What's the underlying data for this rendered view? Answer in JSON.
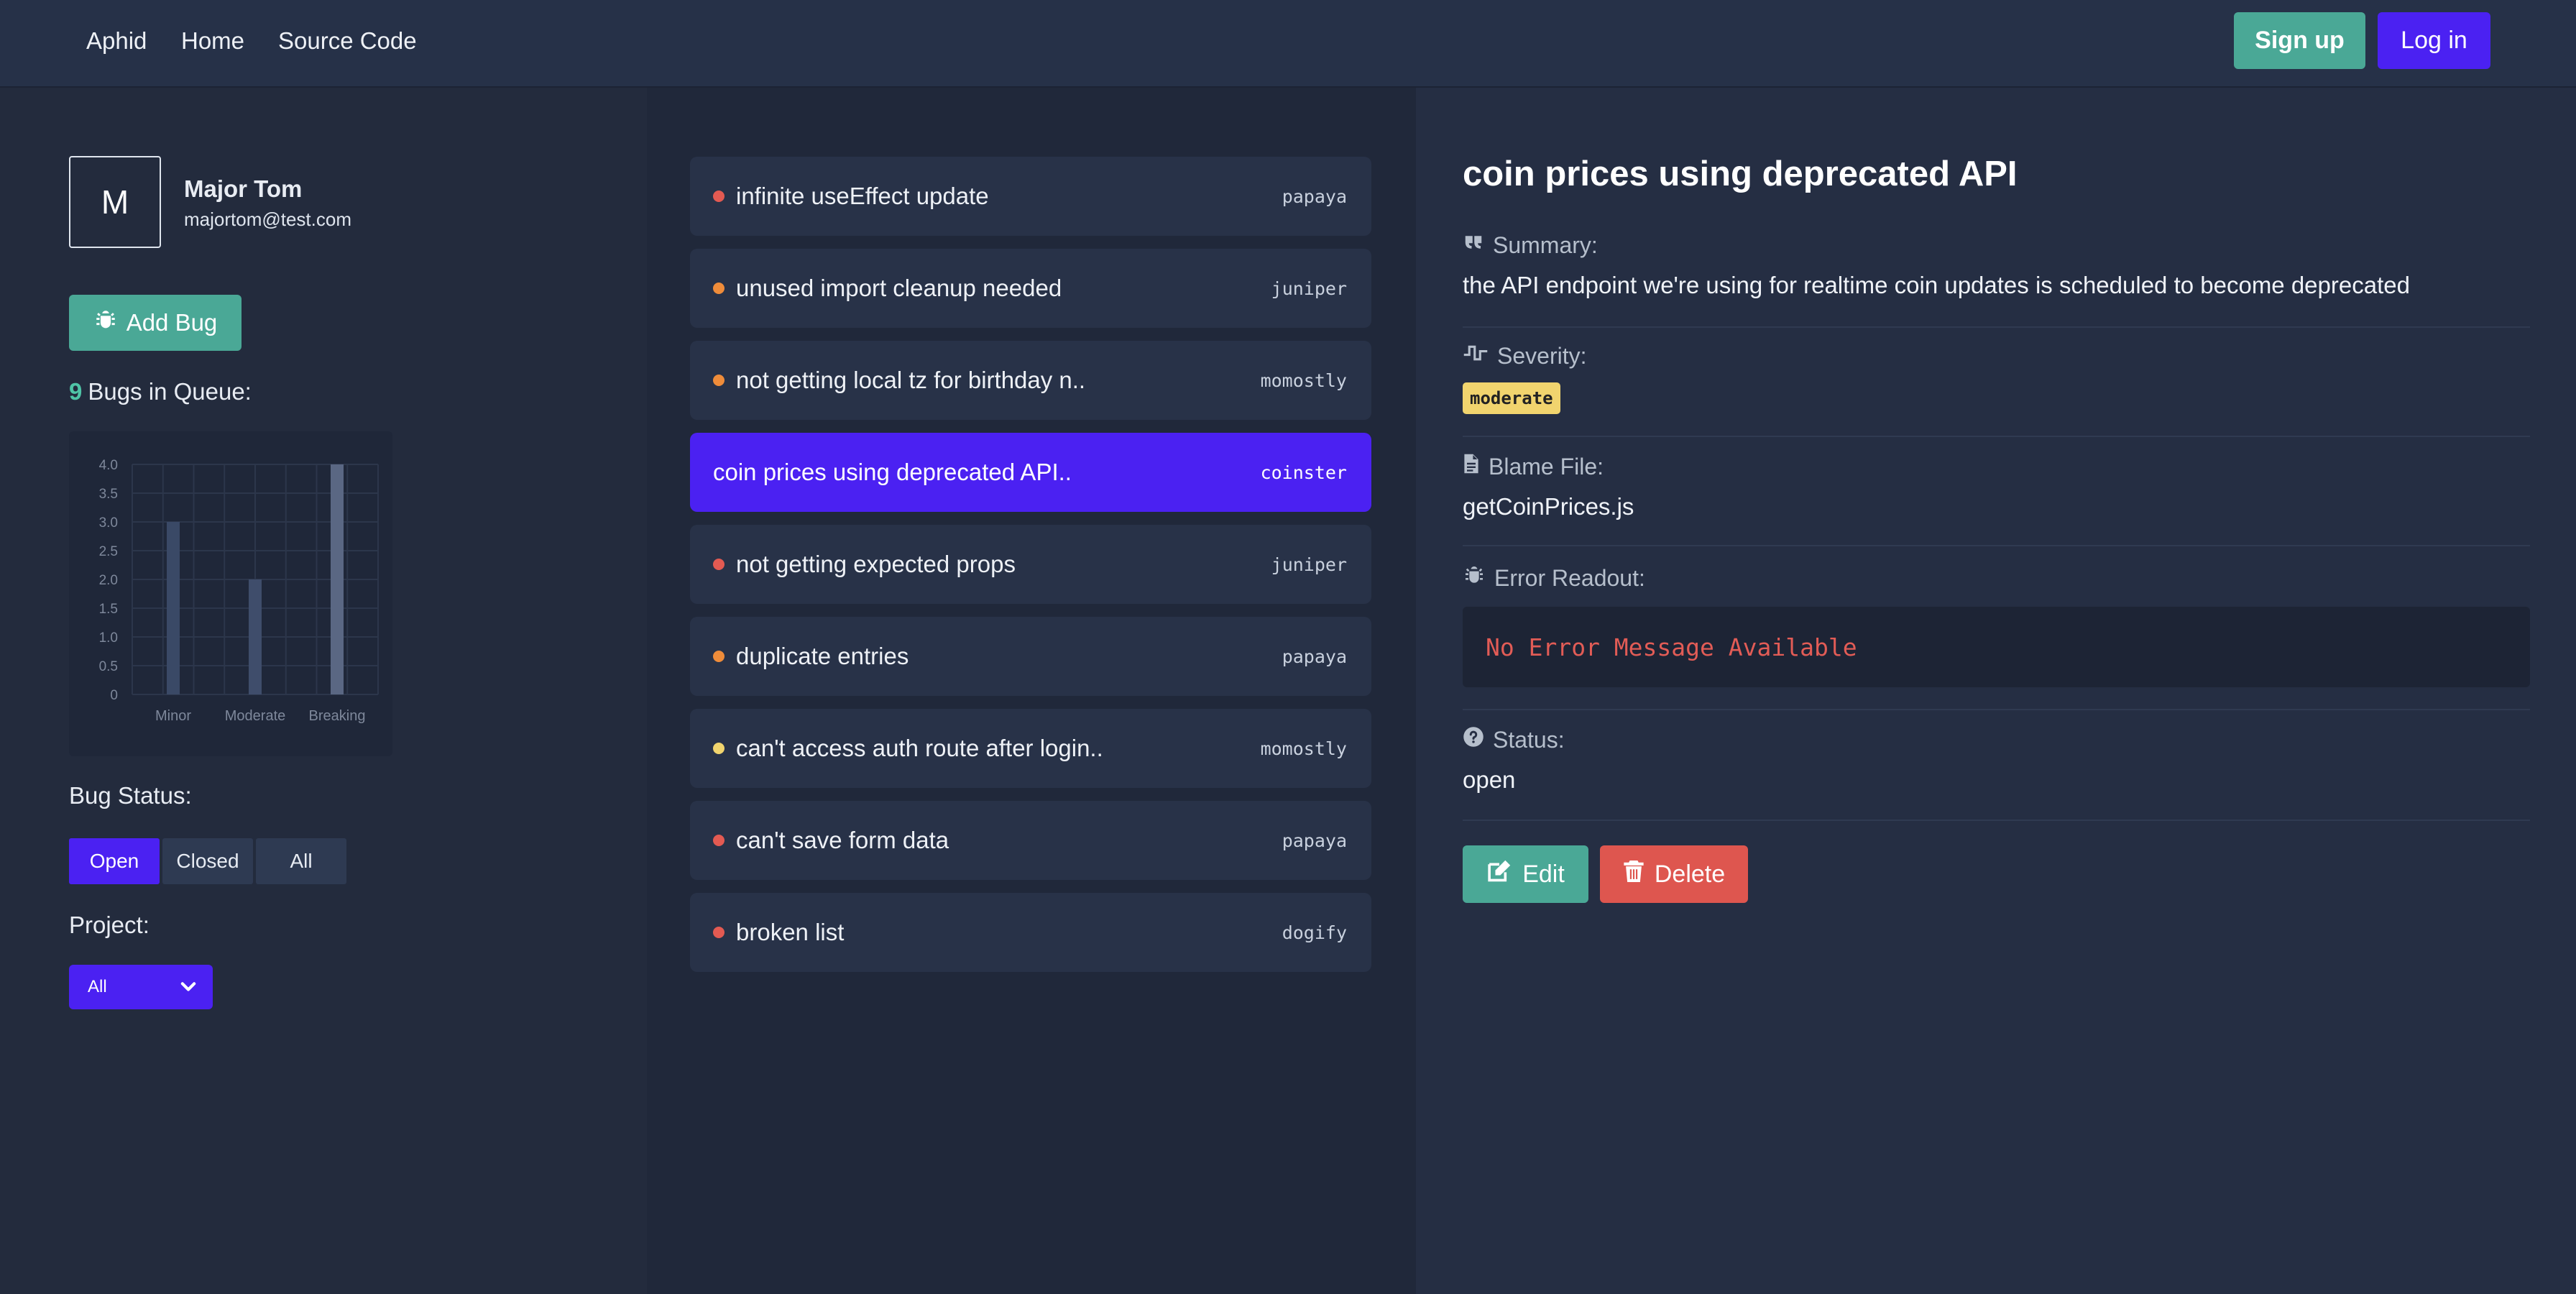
{
  "nav": {
    "brand": "Aphid",
    "links": [
      "Home",
      "Source Code"
    ],
    "signup_label": "Sign up",
    "login_label": "Log in"
  },
  "user": {
    "initial": "M",
    "name": "Major Tom",
    "email": "majortom@test.com"
  },
  "sidebar": {
    "add_bug_label": "Add Bug",
    "queue_count": "9",
    "queue_label": "Bugs in Queue:",
    "bug_status_label": "Bug Status:",
    "status_filters": [
      "Open",
      "Closed",
      "All"
    ],
    "active_filter": "Open",
    "project_label": "Project:",
    "project_selected": "All"
  },
  "chart_data": {
    "type": "bar",
    "categories": [
      "Minor",
      "Moderate",
      "Breaking"
    ],
    "values": [
      3,
      2,
      4
    ],
    "ylim": [
      0,
      4
    ],
    "yticks": [
      "0",
      "0.5",
      "1.0",
      "1.5",
      "2.0",
      "2.5",
      "3.0",
      "3.5",
      "4.0"
    ],
    "grid": true,
    "colors": [
      "#3a4966",
      "#3f4d6b",
      "#5a6783"
    ]
  },
  "bugs": [
    {
      "title": "infinite useEffect update",
      "project": "papaya",
      "color": "#e35a52"
    },
    {
      "title": "unused import cleanup needed",
      "project": "juniper",
      "color": "#ef8c3a"
    },
    {
      "title": "not getting local tz for birthday n..",
      "project": "momostly",
      "color": "#ef8c3a"
    },
    {
      "title": "coin prices using deprecated API..",
      "project": "coinster",
      "color": "",
      "selected": true
    },
    {
      "title": "not getting expected props",
      "project": "juniper",
      "color": "#e35a52"
    },
    {
      "title": "duplicate entries",
      "project": "papaya",
      "color": "#ef8c3a"
    },
    {
      "title": "can't access auth route after login..",
      "project": "momostly",
      "color": "#f1d46e"
    },
    {
      "title": "can't save form data",
      "project": "papaya",
      "color": "#e35a52"
    },
    {
      "title": "broken list",
      "project": "dogify",
      "color": "#e35a52"
    }
  ],
  "detail": {
    "title": "coin prices using deprecated API",
    "summary_label": "Summary:",
    "summary": "the API endpoint we're using for realtime coin updates is scheduled to become deprecated",
    "severity_label": "Severity:",
    "severity": "moderate",
    "blame_label": "Blame File:",
    "blame_file": "getCoinPrices.js",
    "error_label": "Error Readout:",
    "error_text": "No Error Message Available",
    "status_label": "Status:",
    "status": "open",
    "edit_label": "Edit",
    "delete_label": "Delete"
  }
}
